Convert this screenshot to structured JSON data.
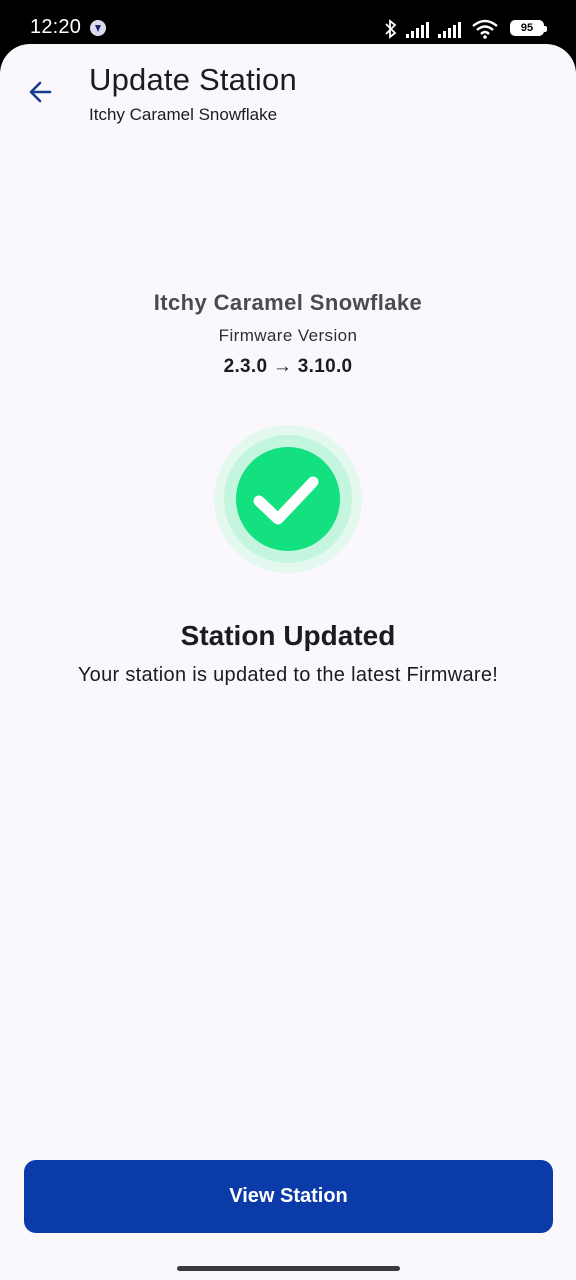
{
  "status_bar": {
    "time": "12:20",
    "battery_level": "95",
    "icons": [
      "app-notification-icon",
      "bluetooth-icon",
      "cell-signal-icon",
      "cell-signal-icon",
      "wifi-icon",
      "battery-icon"
    ]
  },
  "header": {
    "back_icon": "arrow-left-icon",
    "title": "Update Station",
    "subtitle": "Itchy Caramel Snowflake"
  },
  "station": {
    "name": "Itchy Caramel Snowflake",
    "firmware_label": "Firmware Version",
    "firmware_versions": "2.3.0 → 3.10.0"
  },
  "result": {
    "icon": "check-circle-icon",
    "title": "Station Updated",
    "message": "Your station is updated to the latest Firmware!"
  },
  "actions": {
    "view_station_label": "View Station"
  },
  "colors": {
    "background": "#fbf8fd",
    "primary": "#0b3ba8",
    "success": "#13e07e",
    "success_ring_inner": "#c4f5de",
    "success_ring_outer": "#e3f8ee"
  }
}
